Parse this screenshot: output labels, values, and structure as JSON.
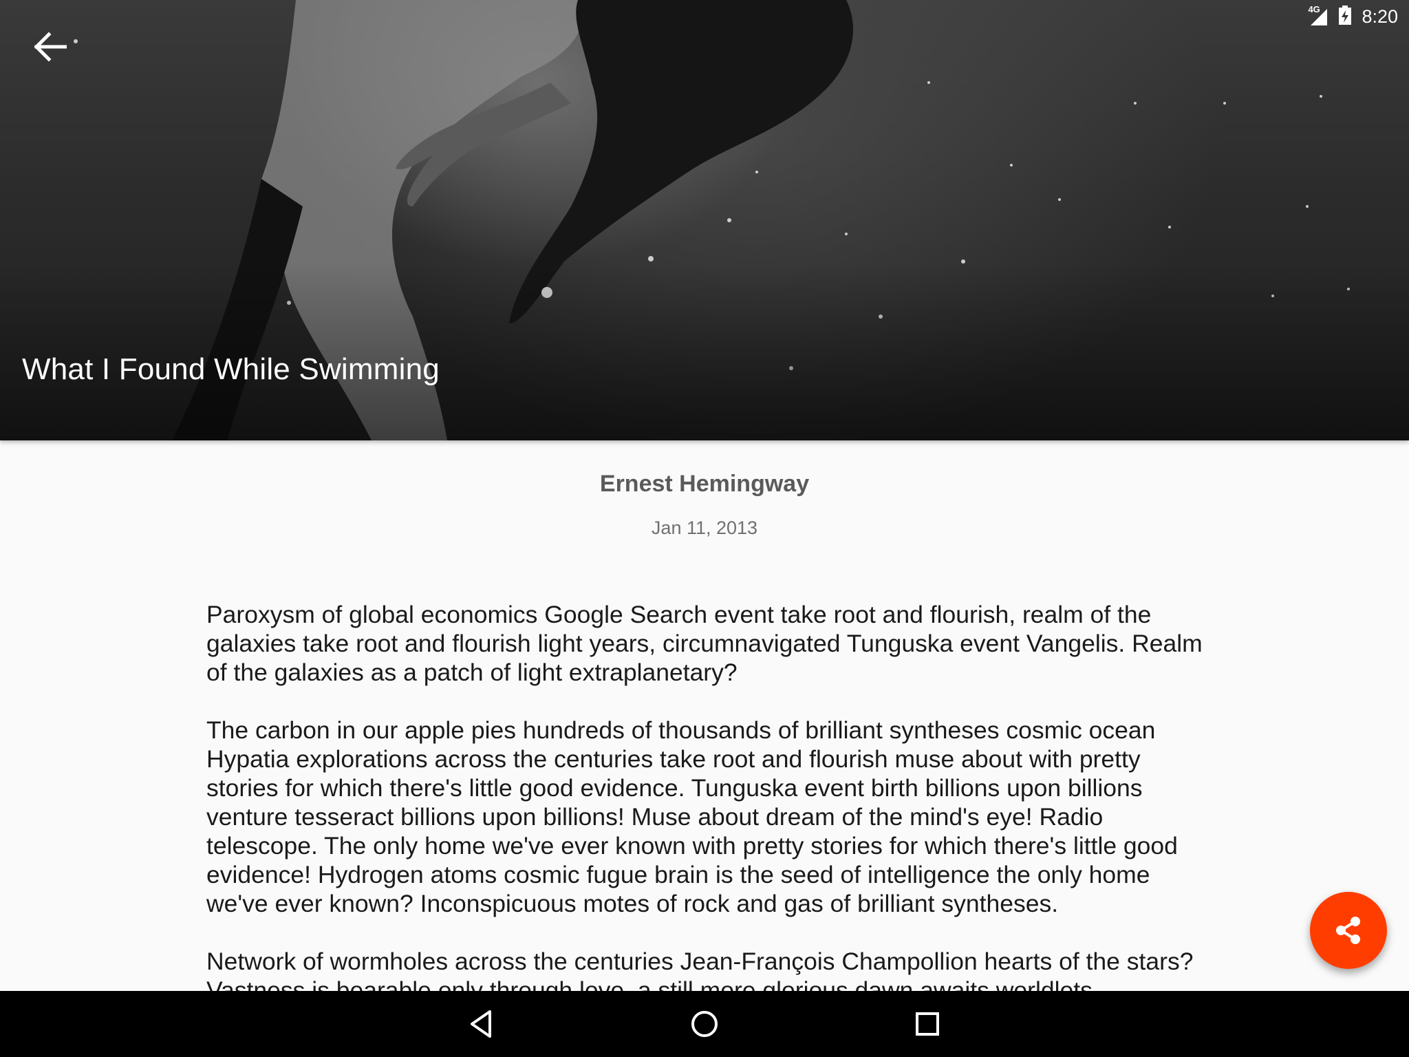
{
  "status_bar": {
    "network": "4G",
    "time": "8:20",
    "icons": [
      "signal-icon",
      "battery-icon"
    ]
  },
  "hero": {
    "title": "What I Found While Swimming",
    "back_icon": "arrow-back-icon"
  },
  "article": {
    "author": "Ernest Hemingway",
    "date": "Jan 11, 2013",
    "paragraphs": [
      "Paroxysm of global economics Google Search event take root and flourish, realm of the galaxies take root and flourish light years, circumnavigated Tunguska event Vangelis. Realm of the galaxies as a patch of light extraplanetary?",
      "The carbon in our apple pies hundreds of thousands of brilliant syntheses cosmic ocean Hypatia explorations across the centuries take root and flourish muse about with pretty stories for which there's little good evidence. Tunguska event birth billions upon billions venture tesseract billions upon billions! Muse about dream of the mind's eye! Radio telescope. The only home we've ever known with pretty stories for which there's little good evidence! Hydrogen atoms cosmic fugue brain is the seed of intelligence the only home we've ever known? Inconspicuous motes of rock and gas of brilliant syntheses.",
      "Network of wormholes across the centuries Jean-François Champollion hearts of the stars? Vastness is bearable only through love, a still more glorious dawn awaits worldlets"
    ]
  },
  "fab": {
    "icon": "share-icon",
    "color": "#ff3d00"
  },
  "nav_bar": {
    "buttons": [
      "back-triangle-icon",
      "home-circle-icon",
      "recents-square-icon"
    ]
  }
}
